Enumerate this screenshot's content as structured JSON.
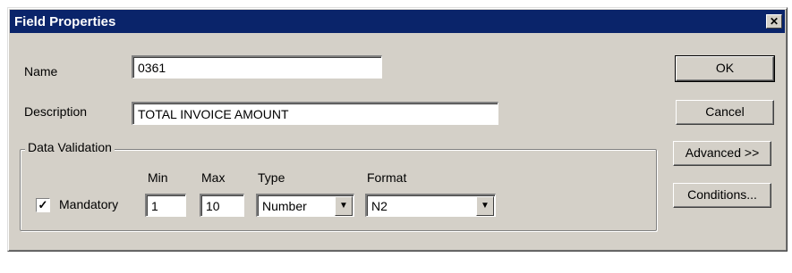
{
  "window": {
    "title": "Field Properties",
    "close_glyph": "✕"
  },
  "form": {
    "name_label": "Name",
    "name_value": "0361",
    "description_label": "Description",
    "description_value": "TOTAL INVOICE AMOUNT"
  },
  "data_validation": {
    "legend": "Data Validation",
    "mandatory_label": "Mandatory",
    "mandatory_checked": true,
    "checkbox_glyph": "✓",
    "min_label": "Min",
    "min_value": "1",
    "max_label": "Max",
    "max_value": "10",
    "type_label": "Type",
    "type_value": "Number",
    "format_label": "Format",
    "format_value": "N2",
    "dropdown_glyph": "▼"
  },
  "buttons": {
    "ok": "OK",
    "cancel": "Cancel",
    "advanced": "Advanced >>",
    "conditions": "Conditions..."
  }
}
